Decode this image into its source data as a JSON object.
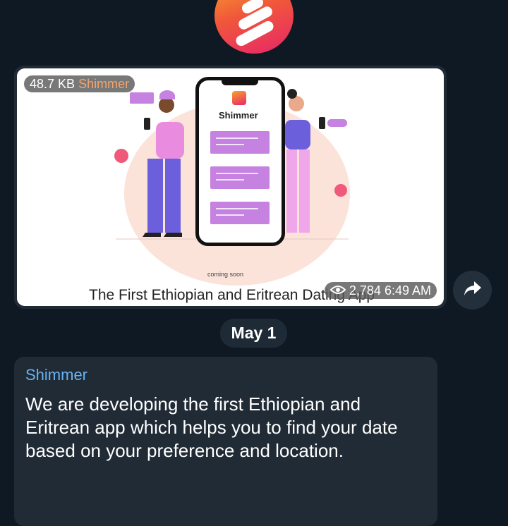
{
  "channel": {
    "avatar_icon": "shimmer-logo-icon",
    "accent_gradient": [
      "#f8a22a",
      "#f0573a",
      "#e8256a"
    ]
  },
  "media_post": {
    "file_size": "48.7 KB",
    "author": "Shimmer",
    "image": {
      "app_name": "Shimmer",
      "coming_soon": "coming soon",
      "caption": "The First Ethiopian and Eritrean Dating App"
    },
    "views": "2,784",
    "time": "6:49 AM",
    "share_icon": "share-arrow-icon"
  },
  "date_separator": "May 1",
  "text_post": {
    "author": "Shimmer",
    "text": "We are developing the first Ethiopian and Eritrean app which helps you to find your date based on your preference and location."
  },
  "colors": {
    "background": "#0f1923",
    "bubble": "#202b36",
    "author_name": "#6ab2f2",
    "media_author": "#f5a46a"
  }
}
